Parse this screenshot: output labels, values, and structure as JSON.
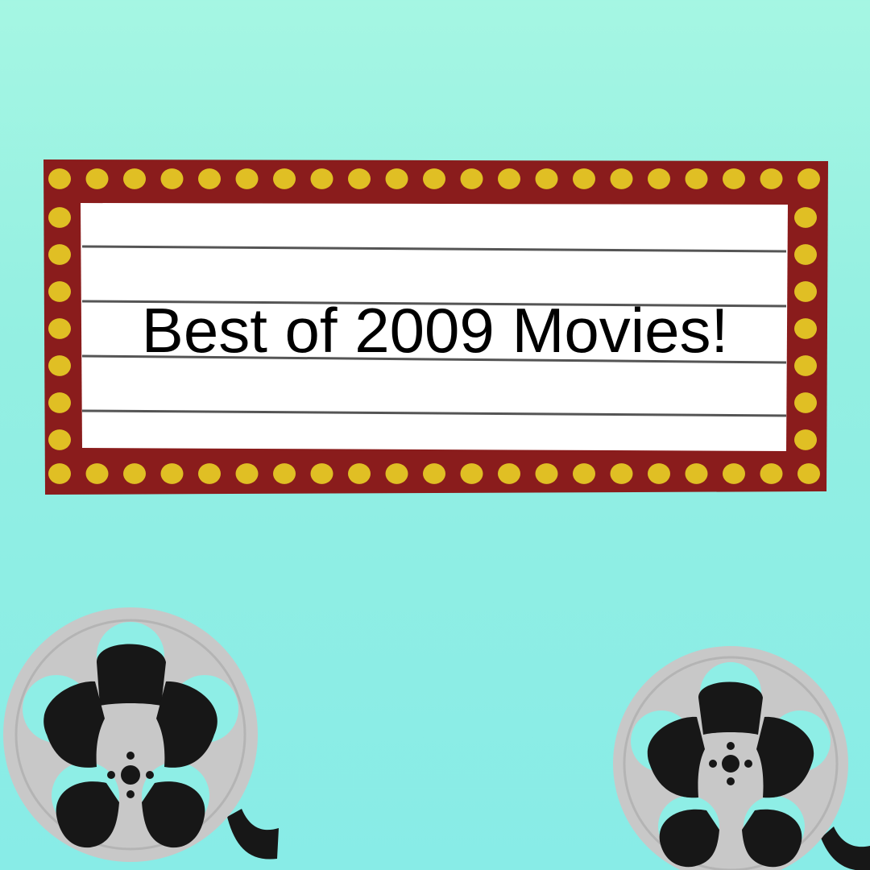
{
  "marquee": {
    "title": "Best of 2009 Movies!"
  },
  "colors": {
    "background_top": "#a5f6e3",
    "background_bottom": "#88ece7",
    "marquee_frame": "#8a1c1c",
    "marquee_bulb": "#e0bf24",
    "marquee_board": "#ffffff",
    "board_line": "#555555",
    "reel_silver": "#c8c8c8",
    "reel_hole": "#171717",
    "film_strip": "#171717"
  },
  "icons": {
    "left_reel": "film-reel-icon",
    "right_reel": "film-reel-icon",
    "marquee_bulbs": "light-bulb-icon"
  }
}
